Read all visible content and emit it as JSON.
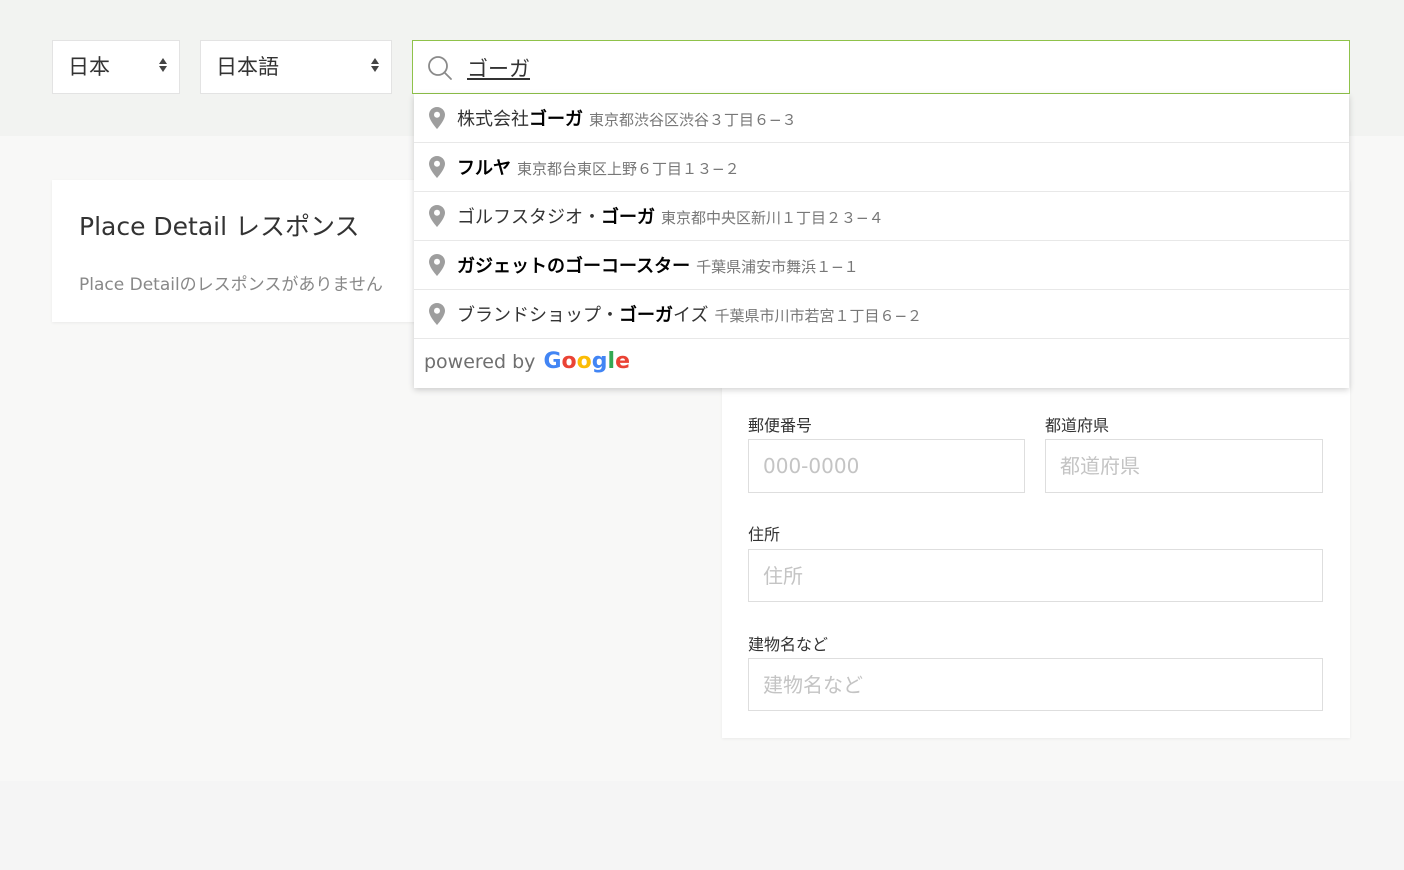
{
  "country_select": {
    "value": "日本"
  },
  "language_select": {
    "value": "日本語"
  },
  "search": {
    "value": "ゴーガ"
  },
  "suggestions": [
    {
      "prefix": "株式会社",
      "match": "ゴーガ",
      "suffix": "",
      "address": "東京都渋谷区渋谷３丁目６−３"
    },
    {
      "prefix": "",
      "match": "フルヤ",
      "suffix": "",
      "address": "東京都台東区上野６丁目１３−２"
    },
    {
      "prefix": "ゴルフスタジオ・",
      "match": "ゴーガ",
      "suffix": "",
      "address": "東京都中央区新川１丁目２３−４"
    },
    {
      "prefix": "",
      "match": "ガジェットのゴーコースター",
      "suffix": "",
      "address": "千葉県浦安市舞浜１−１"
    },
    {
      "prefix": "ブランドショップ・",
      "match": "ゴーガ",
      "suffix": "イズ",
      "address": "千葉県市川市若宮１丁目６−２"
    }
  ],
  "powered_by": {
    "text": "powered by",
    "google": "Google"
  },
  "place_detail": {
    "title": "Place Detail レスポンス",
    "message": "Place Detailのレスポンスがありません"
  },
  "form": {
    "postal": {
      "label": "郵便番号",
      "placeholder": "000-0000"
    },
    "prefecture": {
      "label": "都道府県",
      "placeholder": "都道府県"
    },
    "address": {
      "label": "住所",
      "placeholder": "住所"
    },
    "building": {
      "label": "建物名など",
      "placeholder": "建物名など"
    }
  },
  "colors": {
    "focus_border": "#8fc24a",
    "pin": "#9e9e9e"
  },
  "icons": {
    "search": "search-icon",
    "pin": "map-pin-icon"
  }
}
